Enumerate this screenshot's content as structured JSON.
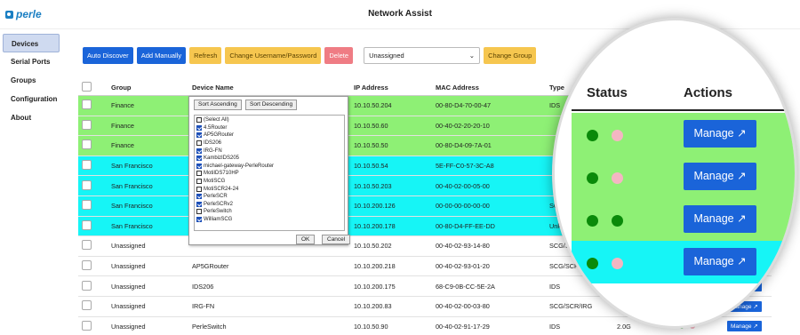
{
  "app": {
    "logo": "perle",
    "title": "Network Assist"
  },
  "sidebar": {
    "items": [
      {
        "label": "Devices",
        "active": true
      },
      {
        "label": "Serial Ports"
      },
      {
        "label": "Groups"
      },
      {
        "label": "Configuration"
      },
      {
        "label": "About"
      }
    ]
  },
  "toolbar": {
    "auto_discover": "Auto Discover",
    "add_manually": "Add Manually",
    "refresh": "Refresh",
    "change_credentials": "Change Username/Password",
    "delete": "Delete",
    "group_select": "Unassigned",
    "change_group": "Change Group"
  },
  "table": {
    "headers": {
      "group": "Group",
      "device_name": "Device Name",
      "ip": "IP Address",
      "mac": "MAC Address",
      "type": "Type"
    },
    "manage_label": "Manage ↗",
    "rows": [
      {
        "group": "Finance",
        "name": "",
        "ip": "10.10.50.204",
        "mac": "00-80-D4-70-00-47",
        "type": "IDS",
        "release": "",
        "highlight": "green",
        "dots": [
          "#0a8a0a",
          "#f4b6c2"
        ]
      },
      {
        "group": "Finance",
        "name": "",
        "ip": "10.10.50.60",
        "mac": "00-40-02-20-20-10",
        "type": "",
        "release": "",
        "highlight": "green",
        "dots": [
          "#0a8a0a",
          "#f4b6c2"
        ]
      },
      {
        "group": "Finance",
        "name": "",
        "ip": "10.10.50.50",
        "mac": "00-80-D4-09-7A-01",
        "type": "",
        "release": "",
        "highlight": "green",
        "dots": [
          "#0a8a0a",
          "#0a8a0a"
        ]
      },
      {
        "group": "San Francisco",
        "name": "",
        "ip": "10.10.50.54",
        "mac": "5E-FF-C0-57-3C-A8",
        "type": "",
        "release": "",
        "highlight": "cyan",
        "dots": []
      },
      {
        "group": "San Francisco",
        "name": "",
        "ip": "10.10.50.203",
        "mac": "00-40-02-00-05-00",
        "type": "",
        "release": "",
        "highlight": "cyan",
        "dots": []
      },
      {
        "group": "San Francisco",
        "name": "",
        "ip": "10.10.200.126",
        "mac": "00-00-00-00-00-00",
        "type": "SCG",
        "release": "",
        "highlight": "cyan",
        "dots": []
      },
      {
        "group": "San Francisco",
        "name": "",
        "ip": "10.10.200.178",
        "mac": "00-80-D4-FF-EE-DD",
        "type": "Unknow",
        "release": "",
        "highlight": "cyan",
        "dots": []
      },
      {
        "group": "Unassigned",
        "name": "",
        "ip": "10.10.50.202",
        "mac": "00-40-02-93-14-80",
        "type": "SCG/SCR/IRG",
        "release": "",
        "highlight": "",
        "dots": []
      },
      {
        "group": "Unassigned",
        "name": "AP5GRouter",
        "ip": "10.10.200.218",
        "mac": "00-40-02-93-01-20",
        "type": "SCG/SCR/IRG",
        "release": "",
        "highlight": "",
        "dots": []
      },
      {
        "group": "Unassigned",
        "name": "IDS206",
        "ip": "10.10.200.175",
        "mac": "68-C9-0B-CC-5E-2A",
        "type": "IDS",
        "release": "2.0T",
        "highlight": "",
        "dots": [
          "#0a8a0a",
          "#f4b6c2"
        ]
      },
      {
        "group": "Unassigned",
        "name": "IRG-FN",
        "ip": "10.10.200.83",
        "mac": "00-40-02-00-03-80",
        "type": "SCG/SCR/IRG",
        "release": "7.0G",
        "highlight": "",
        "dots": [
          "#f0a81a",
          "#f0a81a"
        ]
      },
      {
        "group": "Unassigned",
        "name": "PerleSwitch",
        "ip": "10.10.50.90",
        "mac": "00-40-02-91-17-29",
        "type": "IDS",
        "release": "2.0G",
        "highlight": "",
        "dots": [
          "#0a8a0a",
          "#f4b6c2"
        ]
      }
    ]
  },
  "filter_popup": {
    "sort_asc": "Sort Ascending",
    "sort_desc": "Sort Descending",
    "items": [
      {
        "label": "(Select All)",
        "checked": false
      },
      {
        "label": "4.5Router",
        "checked": true
      },
      {
        "label": "AP5GRouter",
        "checked": true
      },
      {
        "label": "IDS206",
        "checked": false
      },
      {
        "label": "IRG-FN",
        "checked": true
      },
      {
        "label": "KambizIDS205",
        "checked": true
      },
      {
        "label": "michael-gateway-PerleRouter",
        "checked": true
      },
      {
        "label": "MotiIDS710HP",
        "checked": false
      },
      {
        "label": "MotiSCG",
        "checked": false
      },
      {
        "label": "MotiSCR24-24",
        "checked": false
      },
      {
        "label": "PerleSCR",
        "checked": true
      },
      {
        "label": "PerleSCRv2",
        "checked": true
      },
      {
        "label": "PerleSwitch",
        "checked": false
      },
      {
        "label": "WilliamSCG",
        "checked": true
      }
    ],
    "ok": "OK",
    "cancel": "Cancel"
  },
  "magnifier": {
    "status_header": "Status",
    "actions_header": "Actions",
    "manage_label": "Manage ↗",
    "rows": [
      {
        "highlight": "green",
        "dots": [
          "#0a8a0a",
          "#f4b6c2"
        ]
      },
      {
        "highlight": "green",
        "dots": [
          "#0a8a0a",
          "#f4b6c2"
        ]
      },
      {
        "highlight": "green",
        "dots": [
          "#0a8a0a",
          "#0a8a0a"
        ]
      },
      {
        "highlight": "cyan",
        "dots": [
          "#0a8a0a",
          "#f4b6c2"
        ]
      }
    ]
  },
  "colors": {
    "accent": "#1a64d9",
    "green_row": "#8ef075",
    "cyan_row": "#16f5f6",
    "yellow_button": "#f6c64f",
    "red_button": "#ef7c84"
  }
}
